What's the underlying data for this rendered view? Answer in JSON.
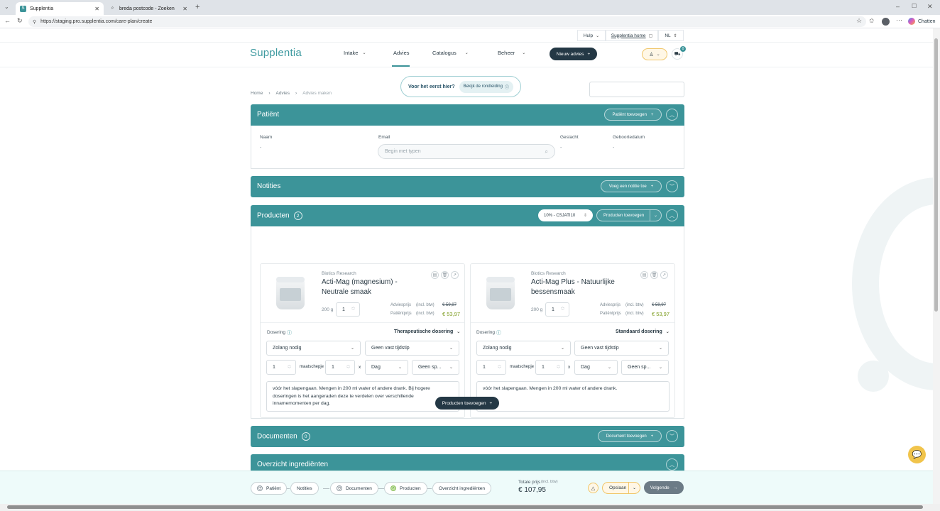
{
  "browser": {
    "tabs": [
      {
        "title": "Supplentia",
        "icon": "S"
      },
      {
        "title": "breda postcode - Zoeken",
        "icon": "Q"
      }
    ],
    "url": "https://staging.pro.supplentia.com/care-plan/create",
    "chat_label": "Chatten"
  },
  "util_bar": {
    "help": "Hulp",
    "home": "Supplentia home",
    "lang": "NL"
  },
  "header": {
    "logo": "Supplentia",
    "nav": [
      "Intake",
      "Advies",
      "Catalogus",
      "Beheer"
    ],
    "new_advice": "Nieuw advies",
    "cart_count": "0"
  },
  "breadcrumb": [
    "Home",
    "Advies",
    "Advies maken"
  ],
  "tour": {
    "question": "Voor het eerst hier?",
    "button": "Bekijk de rondleiding"
  },
  "patient": {
    "title": "Patiënt",
    "add_button": "Patiënt toevoegen",
    "fields": {
      "name_label": "Naam",
      "name_value": "-",
      "email_label": "Email",
      "email_placeholder": "Begin met typen",
      "gender_label": "Geslacht",
      "gender_value": "-",
      "dob_label": "Geboortedatum",
      "dob_value": "-"
    }
  },
  "notes": {
    "title": "Notities",
    "add_button": "Voeg een notitie toe"
  },
  "products": {
    "title": "Producten",
    "count": "2",
    "discount": "10% - CSJATI10",
    "add_button": "Producten toevoegen",
    "add_button_bottom": "Producten toevoegen",
    "items": [
      {
        "brand": "Biotics Research",
        "name_line1": "Acti-Mag (magnesium) -",
        "name_line2": "Neutrale smaak",
        "size": "200 g",
        "qty": "1",
        "advice_label": "Adviesprijs",
        "patient_label": "Patiëntprijs",
        "incl": "(incl. btw)",
        "advice_price": "€ 59,97",
        "patient_price": "€ 53,97",
        "dosage_label": "Dosering",
        "dosage_type": "Therapeutische dosering",
        "frequency": "Zolang nodig",
        "timing": "Geen vast tijdstip",
        "amount": "1",
        "unit": "maatschepje",
        "times": "1",
        "x": "x",
        "period": "Dag",
        "extra": "Geen sp...",
        "instructions": "vóór het slapengaan. Mengen in 200 ml water of andere drank. Bij hogere doseringen is het aangeraden deze te verdelen over verschillende innamemomenten per dag."
      },
      {
        "brand": "Biotics Research",
        "name_line1": "Acti-Mag Plus - Natuurlijke",
        "name_line2": "bessensmaak",
        "size": "200 g",
        "qty": "1",
        "advice_label": "Adviesprijs",
        "patient_label": "Patiëntprijs",
        "incl": "(incl. btw)",
        "advice_price": "€ 59,97",
        "patient_price": "€ 53,97",
        "dosage_label": "Dosering",
        "dosage_type": "Standaard dosering",
        "frequency": "Zolang nodig",
        "timing": "Geen vast tijdstip",
        "amount": "1",
        "unit": "maatschepje",
        "times": "1",
        "x": "x",
        "period": "Dag",
        "extra": "Geen sp...",
        "instructions": "vóór het slapengaan. Mengen in 200 ml water of andere drank."
      }
    ]
  },
  "documents": {
    "title": "Documenten",
    "count": "0",
    "add_button": "Document toevoegen"
  },
  "ingredients": {
    "title": "Overzicht ingrediënten"
  },
  "footer": {
    "steps": [
      "Patiënt",
      "Notities",
      "Documenten",
      "Producten",
      "Overzicht ingrediënten"
    ],
    "total_label": "Totale prijs",
    "total_incl": "(incl. btw)",
    "total_value": "€ 107,95",
    "save": "Opslaan",
    "next": "Volgende"
  },
  "colors": {
    "primary": "#3c9499",
    "dark": "#243845",
    "accent_price": "#7a9a1a",
    "chat": "#f1c44b"
  }
}
